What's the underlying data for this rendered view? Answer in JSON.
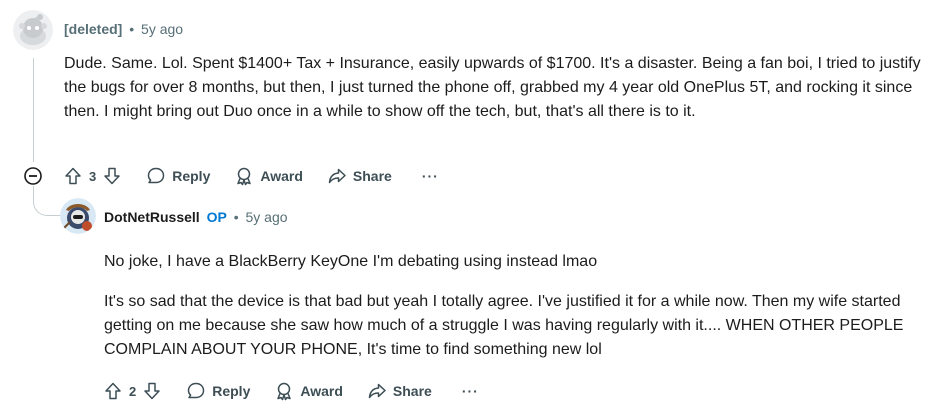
{
  "comments": [
    {
      "author": "[deleted]",
      "separator": "•",
      "time": "5y ago",
      "paragraphs": [
        "Dude. Same. Lol. Spent $1400+ Tax + Insurance, easily upwards of $1700. It's a disaster. Being a fan boi, I tried to justify the bugs for over 8 months, but then, I just turned the phone off, grabbed my 4 year old OnePlus 5T, and rocking it since then. I might bring out Duo once in a while to show off the tech, but, that's all there is to it."
      ],
      "votes": "3",
      "actions": {
        "reply": "Reply",
        "award": "Award",
        "share": "Share",
        "more": "···"
      }
    },
    {
      "author": "DotNetRussell",
      "op_badge": "OP",
      "separator": "•",
      "time": "5y ago",
      "paragraphs": [
        "No joke, I have a BlackBerry KeyOne I'm debating using instead lmao",
        "It's so sad that the device is that bad but yeah I totally agree. I've justified it for a while now. Then my wife started getting on me because she saw how much of a struggle I was having regularly with it.... WHEN OTHER PEOPLE COMPLAIN ABOUT YOUR PHONE, It's time to find something new lol"
      ],
      "votes": "2",
      "actions": {
        "reply": "Reply",
        "award": "Award",
        "share": "Share",
        "more": "···"
      }
    }
  ],
  "icons": {
    "collapse": "minus-circle-icon",
    "upvote": "arrow-up-icon",
    "downvote": "arrow-down-icon",
    "reply": "speech-bubble-icon",
    "award": "award-ribbon-icon",
    "share": "share-arrow-icon"
  },
  "colors": {
    "meta": "#576f76",
    "op": "#0079d3",
    "action": "#3d4e55",
    "thread_line": "#c5ced1"
  }
}
